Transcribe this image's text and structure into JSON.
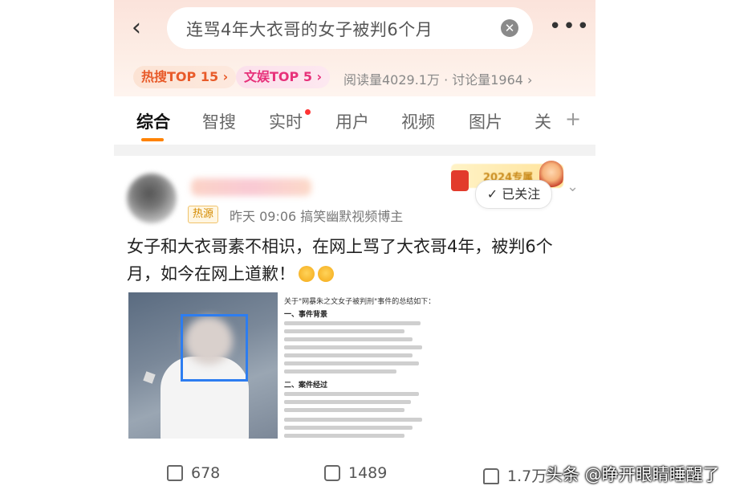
{
  "header": {
    "back_icon": "chevron-left-icon",
    "search_value": "连骂4年大衣哥的女子被判6个月",
    "clear_icon": "close-circle-icon",
    "more_icon": "more-horizontal-icon"
  },
  "chips": [
    {
      "label": "热搜TOP 15 ›",
      "color": "#e85b2a"
    },
    {
      "label": "文娱TOP 5 ›",
      "color": "#e7317a"
    }
  ],
  "stats": "阅读量4029.1万 · 讨论量1964 ›",
  "tabs": [
    "综合",
    "智搜",
    "实时",
    "用户",
    "视频",
    "图片",
    "关"
  ],
  "tab_active": "综合",
  "post": {
    "badge_year": "2024专属",
    "follow_label": "✓ 已关注",
    "source_badge": "热源",
    "meta": "昨天 09:06   搞笑幽默视频博主",
    "content": "女子和大衣哥素不相识，在网上骂了大衣哥4年，被判6个月，如今在网上道歉！",
    "doc_title": "关于\"网暴朱之文女子被判刑\"事件的总结如下：",
    "doc_section1": "一、事件背景",
    "doc_section2": "二、案件经过"
  },
  "actions": {
    "share": "678",
    "comment": "1489",
    "like": "1.7万"
  },
  "watermark": "头条 @睁开眼睛睡醒了",
  "accent": "#ff8200"
}
